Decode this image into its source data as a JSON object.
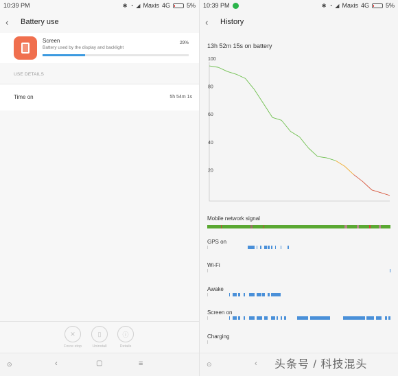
{
  "status": {
    "time": "10:39 PM",
    "carrier": "Maxis",
    "network": "4G",
    "battery": "5%"
  },
  "left": {
    "title": "Battery use",
    "app": {
      "name": "Screen",
      "description": "Battery used by the display and backlight",
      "percent": "29%",
      "usage_fraction": 0.29
    },
    "section_label": "USE DETAILS",
    "time_on": {
      "label": "Time on",
      "value": "5h 54m 1s"
    },
    "actions": [
      {
        "label": "Force stop",
        "icon": "close-icon"
      },
      {
        "label": "Uninstall",
        "icon": "trash-icon"
      },
      {
        "label": "Details",
        "icon": "info-icon"
      }
    ]
  },
  "right": {
    "title": "History",
    "battery_time": "13h 52m 15s on battery",
    "tracks": [
      {
        "name": "mobile-signal",
        "label": "Mobile network signal"
      },
      {
        "name": "gps",
        "label": "GPS on",
        "segments": [
          [
            0.22,
            0.01
          ],
          [
            0.23,
            0.03
          ],
          [
            0.27,
            0.005
          ],
          [
            0.29,
            0.005
          ],
          [
            0.31,
            0.015
          ],
          [
            0.33,
            0.01
          ],
          [
            0.35,
            0.005
          ],
          [
            0.37,
            0.005
          ],
          [
            0.4,
            0.005
          ],
          [
            0.44,
            0.005
          ]
        ]
      },
      {
        "name": "wifi",
        "label": "Wi-Fi",
        "segments": [
          [
            0.995,
            0.005
          ]
        ]
      },
      {
        "name": "awake",
        "label": "Awake",
        "segments": [
          [
            0.12,
            0.005
          ],
          [
            0.14,
            0.02
          ],
          [
            0.17,
            0.01
          ],
          [
            0.2,
            0.005
          ],
          [
            0.23,
            0.03
          ],
          [
            0.27,
            0.025
          ],
          [
            0.3,
            0.015
          ],
          [
            0.33,
            0.01
          ],
          [
            0.35,
            0.05
          ]
        ]
      },
      {
        "name": "screen-on",
        "label": "Screen on",
        "segments": [
          [
            0.12,
            0.005
          ],
          [
            0.14,
            0.02
          ],
          [
            0.17,
            0.01
          ],
          [
            0.2,
            0.005
          ],
          [
            0.23,
            0.03
          ],
          [
            0.27,
            0.03
          ],
          [
            0.31,
            0.02
          ],
          [
            0.35,
            0.02
          ],
          [
            0.38,
            0.005
          ],
          [
            0.4,
            0.01
          ],
          [
            0.42,
            0.01
          ],
          [
            0.49,
            0.06
          ],
          [
            0.56,
            0.11
          ],
          [
            0.74,
            0.12
          ],
          [
            0.87,
            0.04
          ],
          [
            0.92,
            0.03
          ],
          [
            0.97,
            0.01
          ],
          [
            0.99,
            0.01
          ]
        ]
      },
      {
        "name": "charging",
        "label": "Charging",
        "segments": []
      }
    ]
  },
  "chart_data": {
    "type": "line",
    "title": "",
    "xlabel": "",
    "ylabel": "",
    "ylim": [
      0,
      100
    ],
    "yticks": [
      20,
      40,
      60,
      80,
      100
    ],
    "x": [
      0,
      0.05,
      0.1,
      0.15,
      0.2,
      0.25,
      0.3,
      0.35,
      0.4,
      0.45,
      0.5,
      0.55,
      0.6,
      0.65,
      0.7,
      0.75,
      0.8,
      0.85,
      0.9,
      0.95,
      1.0
    ],
    "series": [
      {
        "values": [
          97,
          96,
          93,
          91,
          88,
          80,
          70,
          60,
          58,
          50,
          46,
          38,
          32,
          31,
          29,
          25,
          19,
          14,
          8,
          6,
          4
        ]
      }
    ],
    "colors": {
      "high": "#6cbf4b",
      "mid": "#f0a92a",
      "low": "#d6543a"
    }
  },
  "watermark": "头条号 / 科技混头"
}
